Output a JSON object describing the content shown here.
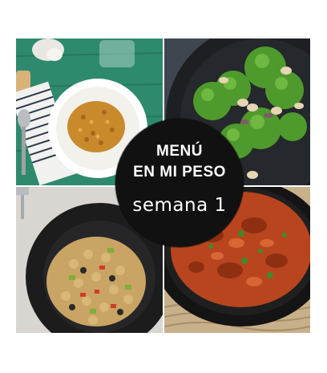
{
  "badge": {
    "title_line1": "MENÚ",
    "title_line2": "EN MI PESO",
    "subtitle": "semana 1"
  },
  "colors": {
    "badge_background": "#111111",
    "badge_text": "#ffffff",
    "wood_table_green": "#2e8a6e",
    "curry_rice": "#c98a2c",
    "broccoli": "#4f9a2c",
    "tomato_stew": "#b8451e",
    "chickpea_salad": "#c9a464"
  },
  "photos": [
    {
      "name": "curry-rice-plate-photo"
    },
    {
      "name": "broccoli-cashew-photo"
    },
    {
      "name": "chickpea-salad-photo"
    },
    {
      "name": "tomato-stew-pan-photo"
    }
  ]
}
